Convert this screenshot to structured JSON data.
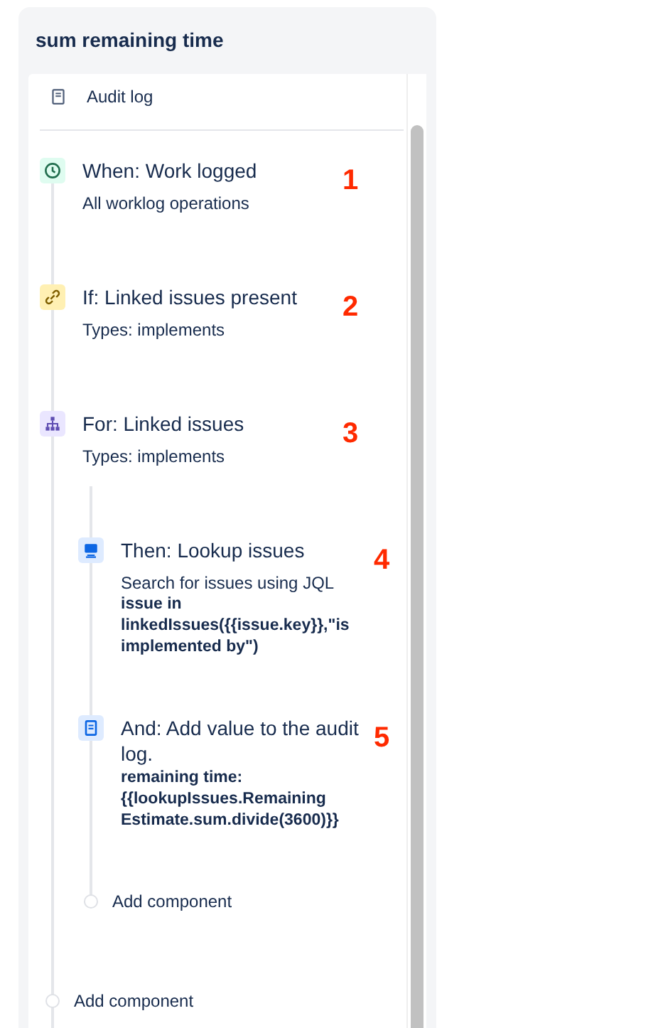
{
  "title": "sum remaining time",
  "audit_log": {
    "label": "Audit log"
  },
  "steps": [
    {
      "kind": "when",
      "title": "When: Work logged",
      "description": "All worklog operations",
      "marker": "1"
    },
    {
      "kind": "if",
      "title": "If: Linked issues present",
      "description": "Types: implements",
      "marker": "2"
    },
    {
      "kind": "for",
      "title": "For: Linked issues",
      "description": "Types: implements",
      "marker": "3",
      "children": [
        {
          "kind": "then",
          "title": "Then: Lookup issues",
          "description": "Search for issues using JQL",
          "detail": "issue in linkedIssues({{issue.key}},\"is implemented by\")",
          "marker": "4"
        },
        {
          "kind": "and",
          "title": "And: Add value to the audit log.",
          "detail": "remaining time: {{lookupIssues.Remaining Estimate.sum.divide(3600)}}",
          "marker": "5"
        }
      ],
      "add_component": "Add component"
    }
  ],
  "add_component": "Add component"
}
